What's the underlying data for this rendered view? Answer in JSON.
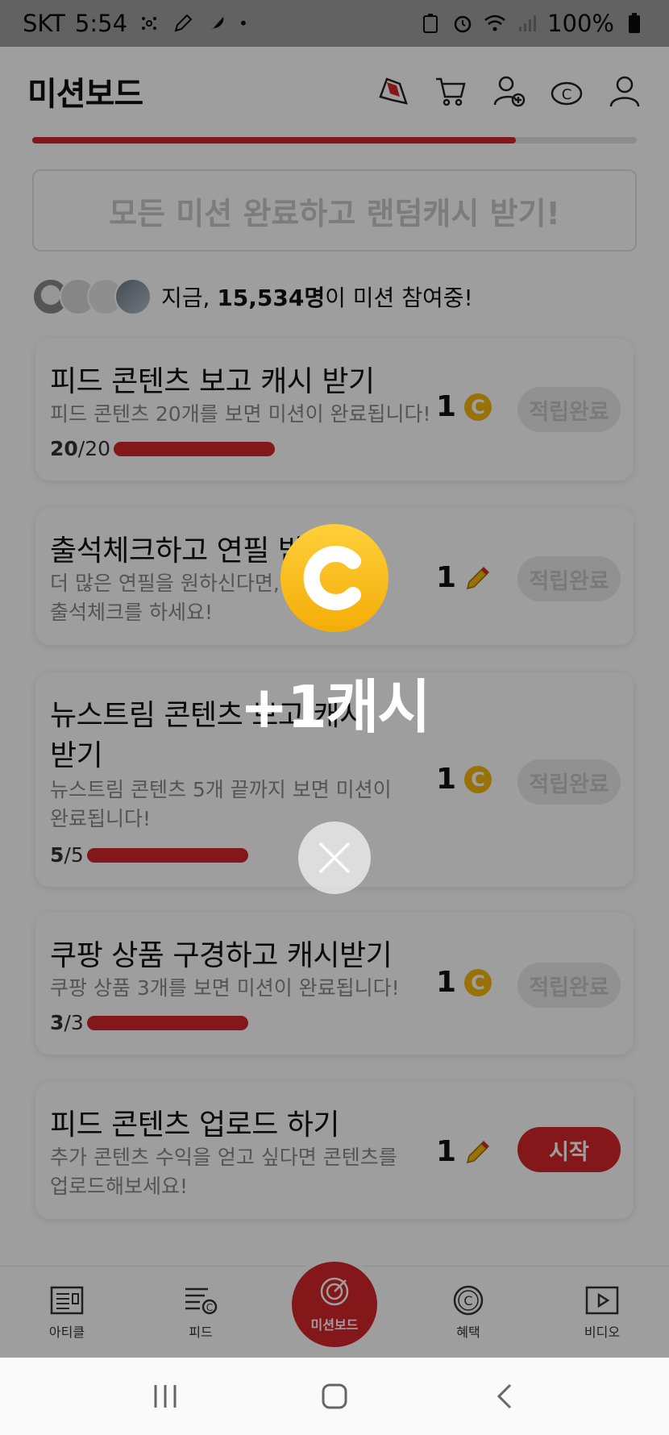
{
  "status_bar": {
    "carrier": "SKT",
    "time": "5:54",
    "battery": "100%"
  },
  "header": {
    "title": "미션보드",
    "icons": [
      "bookmark-badge-icon",
      "cart-icon",
      "add-friend-icon",
      "cash-icon",
      "profile-icon"
    ]
  },
  "mission_progress": {
    "fraction": 0.8
  },
  "random_cash": {
    "label": "모든 미션 완료하고 랜덤캐시 받기!"
  },
  "participants": {
    "prefix": "지금,",
    "count": "15,534명",
    "suffix": "이 미션 참여중!"
  },
  "missions": [
    {
      "title": "피드 콘텐츠 보고 캐시 받기",
      "desc": "피드 콘텐츠 20개를 보면 미션이 완료됩니다!",
      "done": "20",
      "total": "/20",
      "reward": "1",
      "reward_icon": "coin-icon",
      "action": "적립완료"
    },
    {
      "title": "출석체크하고 연필 받기",
      "desc": "더 많은 연필을 원하신다면, 오늘도",
      "desc2": "출석체크를 하세요!",
      "reward": "1",
      "reward_icon": "pencil-icon",
      "action": "적립완료"
    },
    {
      "title": "뉴스트림 콘텐츠 보고 캐시",
      "title2": "받기",
      "desc": "뉴스트림 콘텐츠 5개 끝까지 보면 미션이",
      "desc2": "완료됩니다!",
      "done": "5",
      "total": "/5",
      "reward": "1",
      "reward_icon": "coin-icon",
      "action": "적립완료"
    },
    {
      "title": "쿠팡 상품 구경하고 캐시받기",
      "desc": "쿠팡 상품 3개를 보면 미션이 완료됩니다!",
      "done": "3",
      "total": "/3",
      "reward": "1",
      "reward_icon": "coin-icon",
      "action": "적립완료"
    },
    {
      "title": "피드 콘텐츠 업로드 하기",
      "desc": "추가 콘텐츠 수익을 얻고 싶다면 콘텐츠를",
      "desc2": "업로드해보세요!",
      "reward": "1",
      "reward_icon": "pencil-icon",
      "action": "시작"
    }
  ],
  "bottom_nav": {
    "items": [
      "아티클",
      "피드",
      "미션보드",
      "혜택",
      "비디오"
    ]
  },
  "popup": {
    "coin_letter": "C",
    "reward_text": "+1캐시"
  },
  "colors": {
    "accent": "#d6262a",
    "coin": "#f5b90c",
    "disabled": "#ebebeb"
  }
}
